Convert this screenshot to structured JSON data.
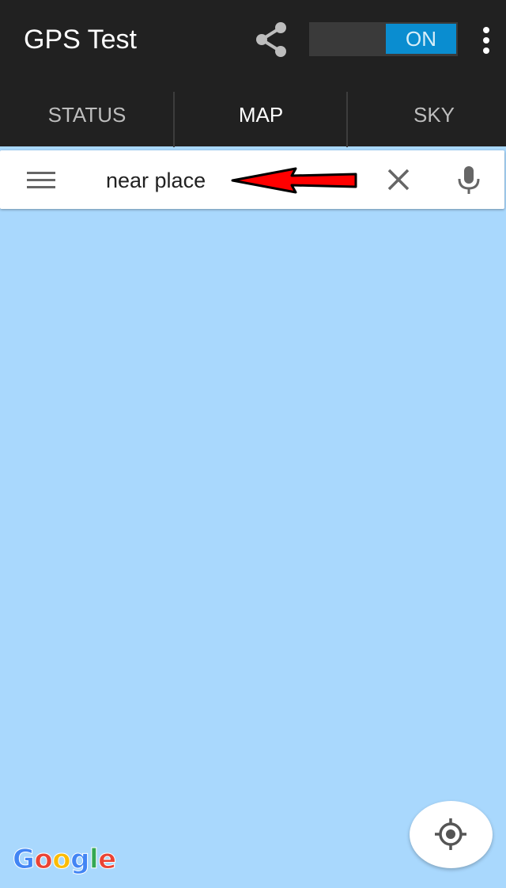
{
  "app_bar": {
    "title": "GPS Test",
    "toggle_label": "ON",
    "share_icon": "share-icon",
    "overflow_icon": "more-vert-icon"
  },
  "tabs": [
    {
      "label": "STATUS",
      "active": false
    },
    {
      "label": "MAP",
      "active": true
    },
    {
      "label": "SKY",
      "active": false
    }
  ],
  "search": {
    "value": "near place",
    "menu_icon": "hamburger-menu-icon",
    "clear_icon": "close-icon",
    "mic_icon": "microphone-icon"
  },
  "map": {
    "background_color": "#a9d8fd",
    "attribution": "Google",
    "locate_icon": "my-location-icon"
  },
  "colors": {
    "app_bar": "#212121",
    "toggle_on": "#0a8dd0",
    "arrow": "#ff0000"
  }
}
